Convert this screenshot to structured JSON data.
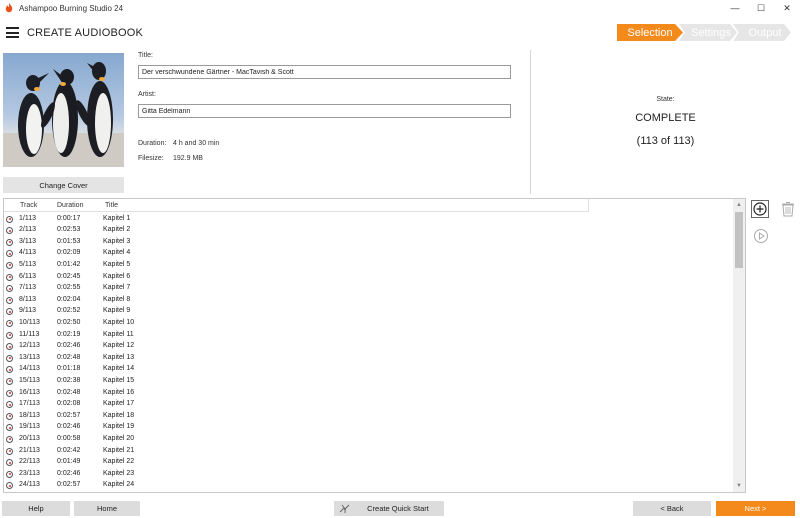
{
  "window": {
    "title": "Ashampoo Burning Studio 24",
    "minimize": "—",
    "maximize": "☐",
    "close": "✕"
  },
  "header": {
    "title": "CREATE AUDIOBOOK",
    "steps": [
      "Selection",
      "Settings",
      "Output"
    ],
    "active_step": "Selection",
    "accent_color": "#f48a1c"
  },
  "cover": {
    "change_label": "Change Cover"
  },
  "fields": {
    "title_label": "Title:",
    "title_value": "Der verschwundene Gärtner - MacTavish & Scott",
    "artist_label": "Artist:",
    "artist_value": "Gitta Edelmann"
  },
  "info": {
    "duration_label": "Duration:",
    "duration_value": "4 h and 30 min",
    "filesize_label": "Filesize:",
    "filesize_value": "192.9 MB"
  },
  "state": {
    "label": "State:",
    "value": "COMPLETE",
    "count": "(113 of 113)"
  },
  "tracklist": {
    "columns": [
      "Track",
      "Duration",
      "Title"
    ],
    "rows": [
      [
        "1/113",
        "0:00:17",
        "Kapitel 1"
      ],
      [
        "2/113",
        "0:02:53",
        "Kapitel 2"
      ],
      [
        "3/113",
        "0:01:53",
        "Kapitel 3"
      ],
      [
        "4/113",
        "0:02:09",
        "Kapitel 4"
      ],
      [
        "5/113",
        "0:01:42",
        "Kapitel 5"
      ],
      [
        "6/113",
        "0:02:45",
        "Kapitel 6"
      ],
      [
        "7/113",
        "0:02:55",
        "Kapitel 7"
      ],
      [
        "8/113",
        "0:02:04",
        "Kapitel 8"
      ],
      [
        "9/113",
        "0:02:52",
        "Kapitel 9"
      ],
      [
        "10/113",
        "0:02:50",
        "Kapitel 10"
      ],
      [
        "11/113",
        "0:02:19",
        "Kapitel 11"
      ],
      [
        "12/113",
        "0:02:46",
        "Kapitel 12"
      ],
      [
        "13/113",
        "0:02:48",
        "Kapitel 13"
      ],
      [
        "14/113",
        "0:01:18",
        "Kapitel 14"
      ],
      [
        "15/113",
        "0:02:38",
        "Kapitel 15"
      ],
      [
        "16/113",
        "0:02:48",
        "Kapitel 16"
      ],
      [
        "17/113",
        "0:02:08",
        "Kapitel 17"
      ],
      [
        "18/113",
        "0:02:57",
        "Kapitel 18"
      ],
      [
        "19/113",
        "0:02:46",
        "Kapitel 19"
      ],
      [
        "20/113",
        "0:00:58",
        "Kapitel 20"
      ],
      [
        "21/113",
        "0:02:42",
        "Kapitel 21"
      ],
      [
        "22/113",
        "0:01:49",
        "Kapitel 22"
      ],
      [
        "23/113",
        "0:02:46",
        "Kapitel 23"
      ],
      [
        "24/113",
        "0:02:57",
        "Kapitel 24"
      ]
    ]
  },
  "side_icons": [
    "add-icon",
    "trash-icon",
    "play-icon"
  ],
  "footer": {
    "help": "Help",
    "home": "Home",
    "quick_start": "Create Quick Start",
    "back": "< Back",
    "next": "Next >"
  }
}
